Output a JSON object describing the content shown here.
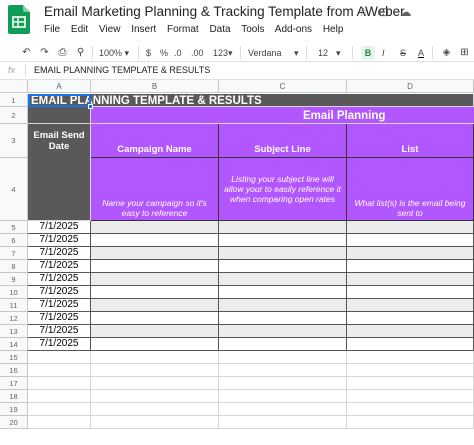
{
  "app": {
    "title": "Email Marketing Planning & Tracking Template from AWeber",
    "logo_color": "#0f9d58",
    "title_icons": [
      "star-icon",
      "move-to-folder-icon",
      "cloud-saved-icon"
    ],
    "menus": [
      "File",
      "Edit",
      "View",
      "Insert",
      "Format",
      "Data",
      "Tools",
      "Add-ons",
      "Help"
    ]
  },
  "toolbar": {
    "zoom": "100%",
    "currency": "$",
    "percent": "%",
    "decimal_decrease": ".0",
    "decimal_increase": ".00",
    "more_formats": "123",
    "font": "Verdana",
    "font_size": "12",
    "bold": "B",
    "italic": "I",
    "strike": "S",
    "text_color": "A"
  },
  "formula_bar": {
    "fx": "fx",
    "value": "EMAIL PLANNING TEMPLATE & RESULTS"
  },
  "sheet": {
    "columns": [
      "A",
      "B",
      "C",
      "D"
    ],
    "row_numbers": [
      "1",
      "2",
      "3",
      "4",
      "5",
      "6",
      "7",
      "8",
      "9",
      "10",
      "11",
      "12",
      "13",
      "14",
      "15",
      "16",
      "17",
      "18",
      "19",
      "20"
    ],
    "title_row": "EMAIL PLANNING TEMPLATE & RESULTS",
    "section_header": "Email Planning",
    "headers": {
      "a": "Email Send Date",
      "b": "Campaign Name",
      "c": "Subject Line",
      "d": "List"
    },
    "notes": {
      "b": "Name your campaign so it's easy to reference",
      "c": "Listing your subject line will allow your to easily reference it when comparing open rates",
      "d": "What list(s) is the email being sent to"
    },
    "dates": [
      "7/1/2025",
      "7/1/2025",
      "7/1/2025",
      "7/1/2025",
      "7/1/2025",
      "7/1/2025",
      "7/1/2025",
      "7/1/2025",
      "7/1/2025",
      "7/1/2025"
    ],
    "colors": {
      "dark_gray": "#595959",
      "purple": "#b256ff",
      "stripe": "#ececec",
      "selection": "#1a73e8"
    }
  }
}
